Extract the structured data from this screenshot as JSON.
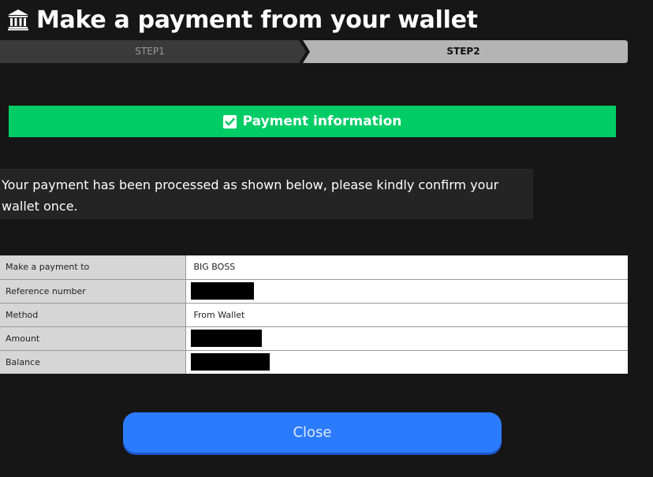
{
  "header": {
    "title": "Make a payment from your wallet",
    "icon": "bank-icon"
  },
  "steps": [
    {
      "label": "STEP1",
      "active": false
    },
    {
      "label": "STEP2",
      "active": true
    }
  ],
  "banner": {
    "icon": "check-square-icon",
    "label": "Payment information",
    "color": "#00cc66"
  },
  "message": "Your payment has been processed as shown below, please kindly confirm your wallet once.",
  "details": [
    {
      "label": "Make a payment to",
      "value": "BIG BOSS",
      "redacted": false
    },
    {
      "label": "Reference number",
      "value": "",
      "redacted": true
    },
    {
      "label": "Method",
      "value": "From Wallet",
      "redacted": false
    },
    {
      "label": "Amount",
      "value": "",
      "redacted": true
    },
    {
      "label": "Balance",
      "value": "",
      "redacted": true
    }
  ],
  "close_button": {
    "label": "Close",
    "color": "#2b7bff"
  }
}
